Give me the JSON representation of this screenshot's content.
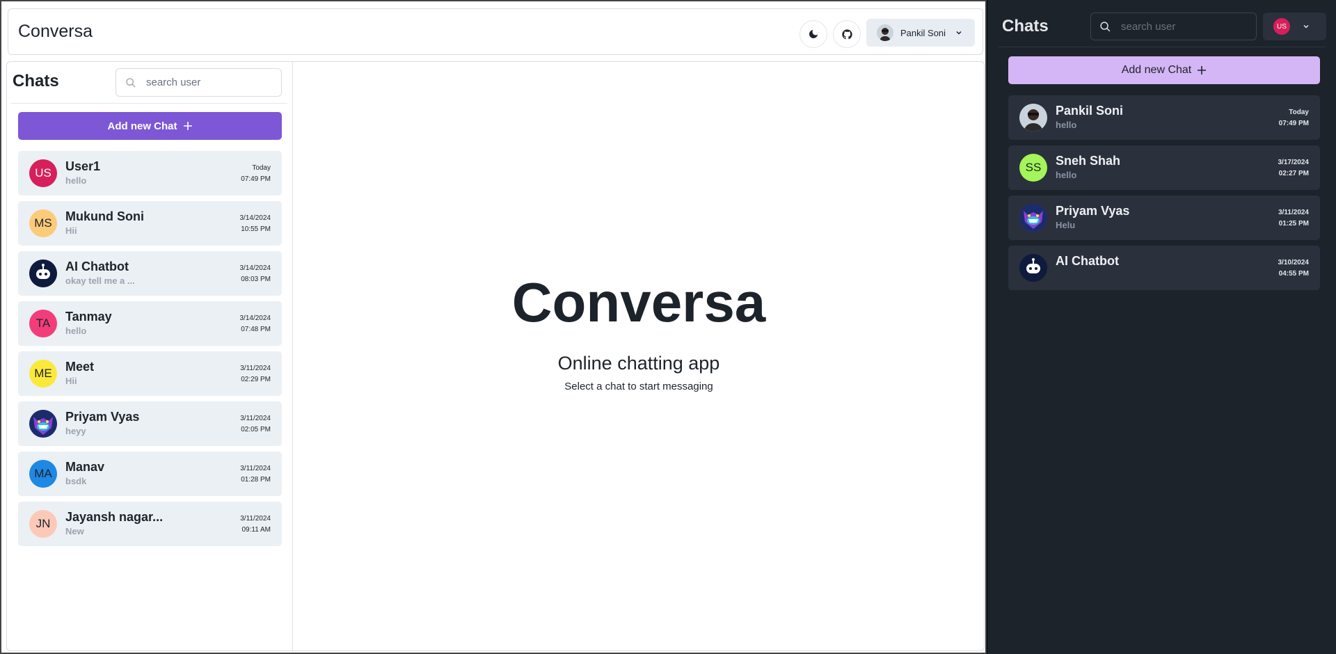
{
  "light": {
    "brand": "Conversa",
    "profile": {
      "name": "Pankil Soni"
    },
    "sidebar": {
      "title": "Chats",
      "search_placeholder": "search user",
      "add_chat_label": "Add new Chat",
      "chats": [
        {
          "initials": "US",
          "name": "User1",
          "last_message": "hello",
          "date": "Today",
          "time": "07:49 PM",
          "avatar_color": "#d61f5b",
          "avatar_text_color": "#ffffff",
          "avatar_type": "initials"
        },
        {
          "initials": "MS",
          "name": "Mukund Soni",
          "last_message": "Hii",
          "date": "3/14/2024",
          "time": "10:55 PM",
          "avatar_color": "#fccb7a",
          "avatar_text_color": "#1d232a",
          "avatar_type": "initials"
        },
        {
          "initials": "",
          "name": "AI Chatbot",
          "last_message": "okay tell me a ...",
          "date": "3/14/2024",
          "time": "08:03 PM",
          "avatar_color": "#0f1b3d",
          "avatar_text_color": "#ffffff",
          "avatar_type": "robot"
        },
        {
          "initials": "TA",
          "name": "Tanmay",
          "last_message": "hello",
          "date": "3/14/2024",
          "time": "07:48 PM",
          "avatar_color": "#f23d7a",
          "avatar_text_color": "#1d232a",
          "avatar_type": "initials"
        },
        {
          "initials": "ME",
          "name": "Meet",
          "last_message": "Hii",
          "date": "3/11/2024",
          "time": "02:29 PM",
          "avatar_color": "#fbe93a",
          "avatar_text_color": "#1d232a",
          "avatar_type": "initials"
        },
        {
          "initials": "",
          "name": "Priyam Vyas",
          "last_message": "heyy",
          "date": "3/11/2024",
          "time": "02:05 PM",
          "avatar_color": "#5b2bb5",
          "avatar_text_color": "#ffffff",
          "avatar_type": "monster"
        },
        {
          "initials": "MA",
          "name": "Manav",
          "last_message": "bsdk",
          "date": "3/11/2024",
          "time": "01:28 PM",
          "avatar_color": "#1e88e5",
          "avatar_text_color": "#1d232a",
          "avatar_type": "initials"
        },
        {
          "initials": "JN",
          "name": "Jayansh nagar...",
          "last_message": "New",
          "date": "3/11/2024",
          "time": "09:11 AM",
          "avatar_color": "#fcc9b8",
          "avatar_text_color": "#1d232a",
          "avatar_type": "initials"
        }
      ]
    },
    "welcome": {
      "title": "Conversa",
      "subtitle": "Online chatting app",
      "hint": "Select a chat to start messaging"
    }
  },
  "dark": {
    "title": "Chats",
    "search_placeholder": "search user",
    "profile_initials": "US",
    "add_chat_label": "Add new Chat",
    "chats": [
      {
        "initials": "",
        "name": "Pankil Soni",
        "last_message": "hello",
        "date": "Today",
        "time": "07:49 PM",
        "avatar_color": "#c9d3dc",
        "avatar_text_color": "#1d232a",
        "avatar_type": "person"
      },
      {
        "initials": "SS",
        "name": "Sneh Shah",
        "last_message": "hello",
        "date": "3/17/2024",
        "time": "02:27 PM",
        "avatar_color": "#a3f55a",
        "avatar_text_color": "#1d232a",
        "avatar_type": "initials"
      },
      {
        "initials": "",
        "name": "Priyam Vyas",
        "last_message": "Helu",
        "date": "3/11/2024",
        "time": "01:25 PM",
        "avatar_color": "#5b2bb5",
        "avatar_text_color": "#ffffff",
        "avatar_type": "monster"
      },
      {
        "initials": "",
        "name": "AI Chatbot",
        "last_message": "",
        "date": "3/10/2024",
        "time": "04:55 PM",
        "avatar_color": "#0f1b3d",
        "avatar_text_color": "#ffffff",
        "avatar_type": "robot"
      }
    ]
  },
  "icons": {
    "theme": "moon-icon",
    "github": "github-icon",
    "dropdown": "chevron-down-icon",
    "search": "search-icon",
    "add": "plus-icon"
  },
  "colors": {
    "accent_light": "#7e57d6",
    "accent_dark": "#d4b5f5",
    "dark_bg": "#1d232a",
    "dark_card": "#2a303c",
    "light_card": "#ebf0f5",
    "user_badge": "#d61f5b"
  }
}
